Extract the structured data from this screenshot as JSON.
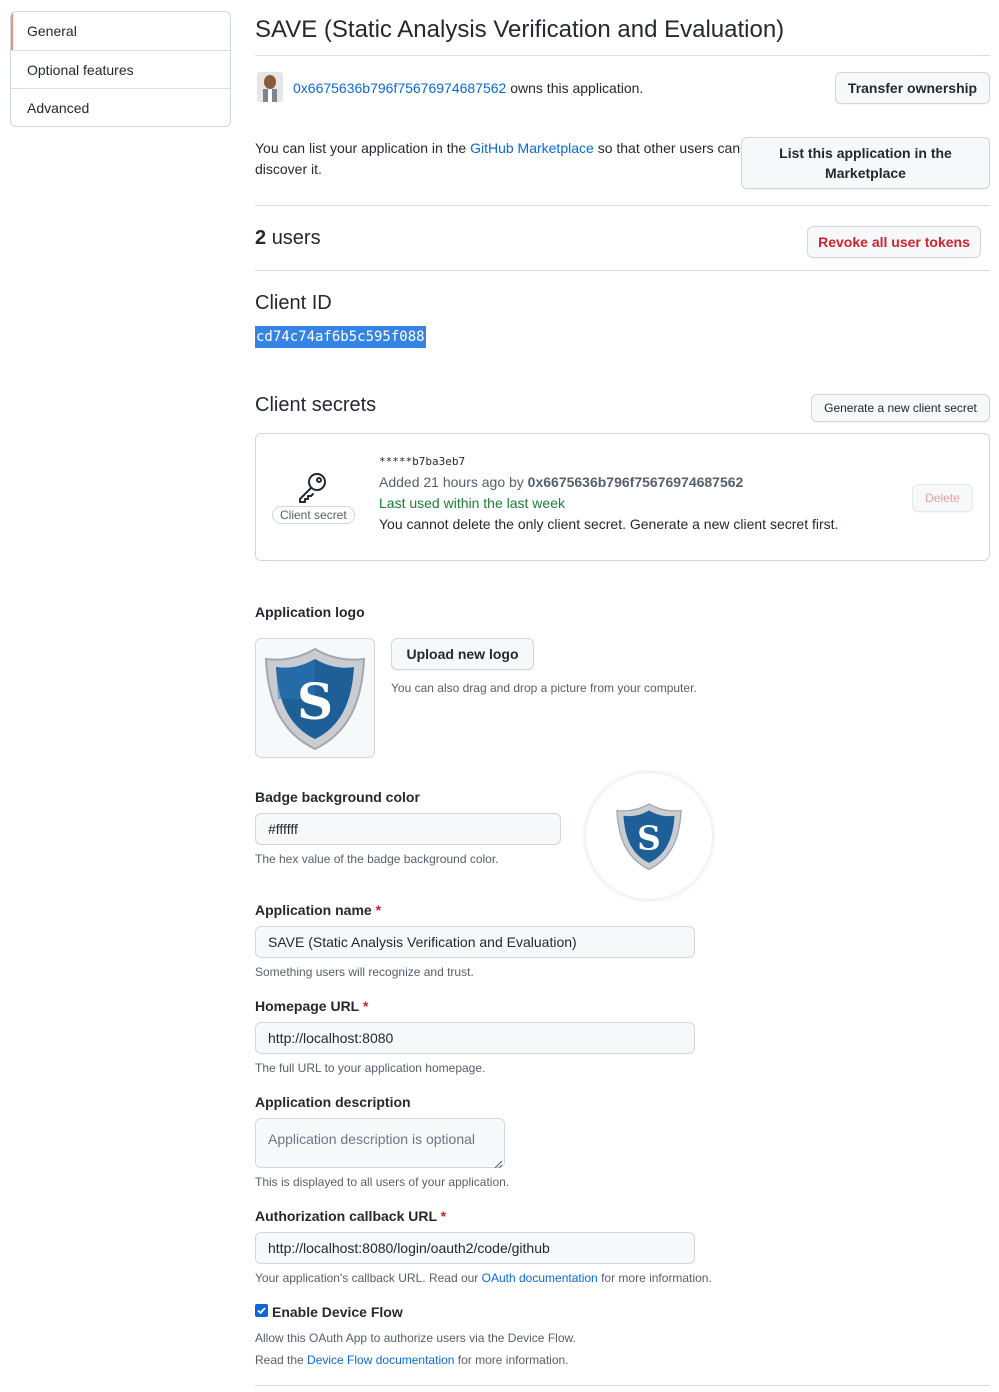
{
  "sidebar": {
    "items": [
      {
        "label": "General"
      },
      {
        "label": "Optional features"
      },
      {
        "label": "Advanced"
      }
    ]
  },
  "header": {
    "title": "SAVE (Static Analysis Verification and Evaluation)"
  },
  "owner": {
    "name": "0x6675636b796f75676974687562",
    "suffix": "owns this application.",
    "transfer_button": "Transfer ownership"
  },
  "marketplace": {
    "text_before": "You can list your application in the",
    "link": "GitHub Marketplace",
    "text_after": "so that other users can",
    "text_line2": "discover it.",
    "button_line1": "List this application in the",
    "button_line2": "Marketplace"
  },
  "users": {
    "count": "2",
    "label": "users",
    "revoke_button": "Revoke all user tokens"
  },
  "client_id": {
    "heading": "Client ID",
    "value": "cd74c74af6b5c595f088"
  },
  "client_secrets": {
    "heading": "Client secrets",
    "generate_button": "Generate a new client secret",
    "icon": "key-icon",
    "pill_label": "Client secret",
    "masked": "*****b7ba3eb7",
    "added_prefix": "Added 21 hours ago by",
    "added_by": "0x6675636b796f75676974687562",
    "last_used": "Last used within the last week",
    "warning": "You cannot delete the only client secret. Generate a new client secret first.",
    "delete_button": "Delete"
  },
  "logo": {
    "label": "Application logo",
    "upload_button": "Upload new logo",
    "hint": "You can also drag and drop a picture from your computer.",
    "letter": "S"
  },
  "badge": {
    "label": "Badge background color",
    "value": "#ffffff",
    "hint": "The hex value of the badge background color."
  },
  "app_name": {
    "label": "Application name",
    "required": "*",
    "value": "SAVE (Static Analysis Verification and Evaluation)",
    "hint": "Something users will recognize and trust."
  },
  "homepage": {
    "label": "Homepage URL",
    "required": "*",
    "value": "http://localhost:8080",
    "hint": "The full URL to your application homepage."
  },
  "description": {
    "label": "Application description",
    "placeholder": "Application description is optional",
    "hint": "This is displayed to all users of your application."
  },
  "callback": {
    "label": "Authorization callback URL",
    "required": "*",
    "value": "http://localhost:8080/login/oauth2/code/github",
    "hint_before": "Your application's callback URL. Read our",
    "hint_link": "OAuth documentation",
    "hint_after": "for more information."
  },
  "device_flow": {
    "label": "Enable Device Flow",
    "checked": true,
    "hint": "Allow this OAuth App to authorize users via the Device Flow.",
    "hint2_before": "Read the",
    "hint2_link": "Device Flow documentation",
    "hint2_after": "for more information."
  },
  "colors": {
    "accent": "#0969da",
    "danger": "#cf222e",
    "success": "#1a7f37",
    "selected_nav": "#fd8c73",
    "selection_highlight": "#3584e4"
  }
}
